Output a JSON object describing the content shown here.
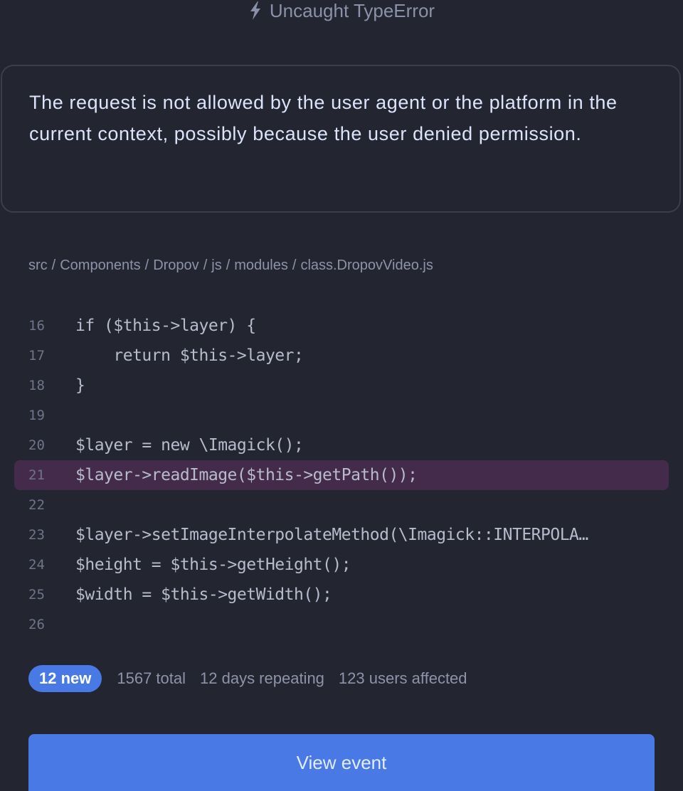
{
  "header": {
    "icon": "lightning-bolt-icon",
    "title": "Uncaught TypeError"
  },
  "message": "The request is not allowed by the user agent or the platform in the current context, possibly because the user denied permission.",
  "breadcrumb": [
    "src",
    "Components",
    "Dropov",
    "js",
    "modules",
    "class.DropovVideo.js"
  ],
  "breadcrumb_separator": "/",
  "code": {
    "highlighted_line": 21,
    "lines": [
      {
        "num": "16",
        "text": "if ($this->layer) {"
      },
      {
        "num": "17",
        "text": "    return $this->layer;"
      },
      {
        "num": "18",
        "text": "}"
      },
      {
        "num": "19",
        "text": ""
      },
      {
        "num": "20",
        "text": "$layer = new \\Imagick();"
      },
      {
        "num": "21",
        "text": "$layer->readImage($this->getPath());"
      },
      {
        "num": "22",
        "text": ""
      },
      {
        "num": "23",
        "text": "$layer->setImageInterpolateMethod(\\Imagick::INTERPOLA…"
      },
      {
        "num": "24",
        "text": "$height = $this->getHeight();"
      },
      {
        "num": "25",
        "text": "$width = $this->getWidth();"
      },
      {
        "num": "26",
        "text": ""
      }
    ]
  },
  "stats": {
    "new_badge": "12 new",
    "total": "1567 total",
    "repeating": "12 days repeating",
    "users": "123 users affected"
  },
  "actions": {
    "view_event_label": "View event"
  },
  "colors": {
    "background": "#232531",
    "accent": "#4879e5",
    "highlight_line": "#452b4b",
    "border": "#3b3e4d"
  }
}
